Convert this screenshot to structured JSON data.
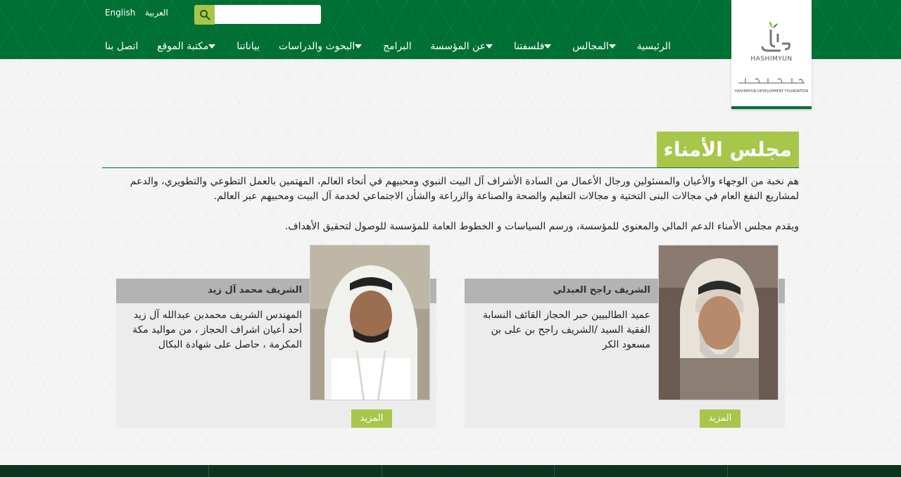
{
  "header": {
    "lang_en": "English",
    "lang_ar": "العربية",
    "search": {
      "placeholder": "",
      "value": ""
    },
    "logo": {
      "english_text": "HASHIMYUN",
      "tagline": "HASHIMYUN DEVELOPMENT FOUNDATION"
    }
  },
  "nav": {
    "items": [
      {
        "label": "الرئيسية",
        "has_dropdown": false
      },
      {
        "label": "المجالس",
        "has_dropdown": true
      },
      {
        "label": "فلسفتنا",
        "has_dropdown": true
      },
      {
        "label": "عن المؤسسة",
        "has_dropdown": true
      },
      {
        "label": "البرامج",
        "has_dropdown": false
      },
      {
        "label": "البحوث والدراسات",
        "has_dropdown": true
      },
      {
        "label": "بياناتنا",
        "has_dropdown": false
      },
      {
        "label": "مكتبة الموقع",
        "has_dropdown": true
      },
      {
        "label": "اتصل بنا",
        "has_dropdown": false
      }
    ]
  },
  "main": {
    "title": "مجلس الأمناء",
    "intro_1": "هم نخبة من الوجهاء والأعيان والمسئولين ورجال الأعمال من السادة الأشراف آل البيت النبوي ومحبيهم في أنحاء العالم، المهتمين بالعمل التطوعي والتطويري، والدعم لمشاريع النفع العام في مجالات البنى التحتية و مجالات التعليم والصحة والصناعة والزراعة والشأن الاجتماعي لخدمة آل البيت ومحبيهم عبر العالم.",
    "intro_2": "ويقدم مجلس الأمناء الدعم المالي والمعنوي للمؤسسة، ورسم السياسات و الخطوط العامة للمؤسسة للوصول لتحقيق الأهداف.",
    "members": [
      {
        "name": "الشريف راجح العبدلي",
        "bio": "عميد الطالبيين حبر الحجاز القائف النسابة الفقية السيد /الشريف راجح بن على بن مسعود الكر",
        "more_label": "المزيد"
      },
      {
        "name": "الشريف محمد آل زيد",
        "bio": "المهندس الشريف محمدبن عبدالله آل زيد أحد أعيان اشراف الحجاز ، من مواليد مكة المكرمة ، حاصل على شهادة البكال",
        "more_label": "المزيد"
      }
    ]
  },
  "colors": {
    "header_green": "#007034",
    "accent_lime": "#a8c64a",
    "footer_dark": "#0b3320"
  }
}
